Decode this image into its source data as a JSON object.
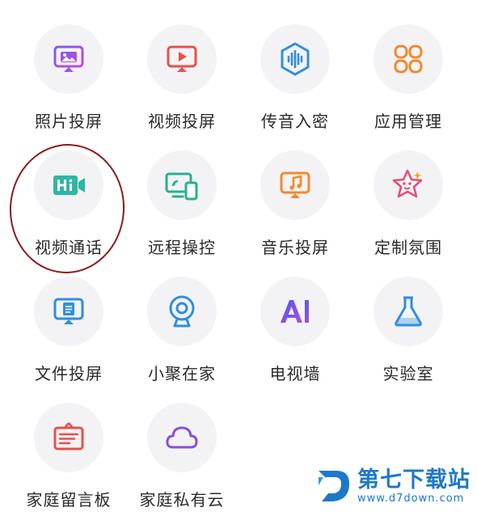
{
  "items": [
    {
      "label": "照片投屏",
      "icon": "photo-cast-icon"
    },
    {
      "label": "视频投屏",
      "icon": "video-cast-icon"
    },
    {
      "label": "传音入密",
      "icon": "voice-secret-icon"
    },
    {
      "label": "应用管理",
      "icon": "app-manage-icon"
    },
    {
      "label": "视频通话",
      "icon": "video-call-icon"
    },
    {
      "label": "远程操控",
      "icon": "remote-control-icon"
    },
    {
      "label": "音乐投屏",
      "icon": "music-cast-icon"
    },
    {
      "label": "定制氛围",
      "icon": "custom-ambience-icon"
    },
    {
      "label": "文件投屏",
      "icon": "file-cast-icon"
    },
    {
      "label": "小聚在家",
      "icon": "webcam-icon"
    },
    {
      "label": "电视墙",
      "icon": "ai-tv-wall-icon"
    },
    {
      "label": "实验室",
      "icon": "lab-flask-icon"
    },
    {
      "label": "家庭留言板",
      "icon": "message-board-icon"
    },
    {
      "label": "家庭私有云",
      "icon": "cloud-icon"
    }
  ],
  "watermark": {
    "title": "第七下载站",
    "url": "www.d7down.com"
  },
  "colors": {
    "highlight": "#8e1b1b",
    "watermark": "#1e78c8"
  }
}
